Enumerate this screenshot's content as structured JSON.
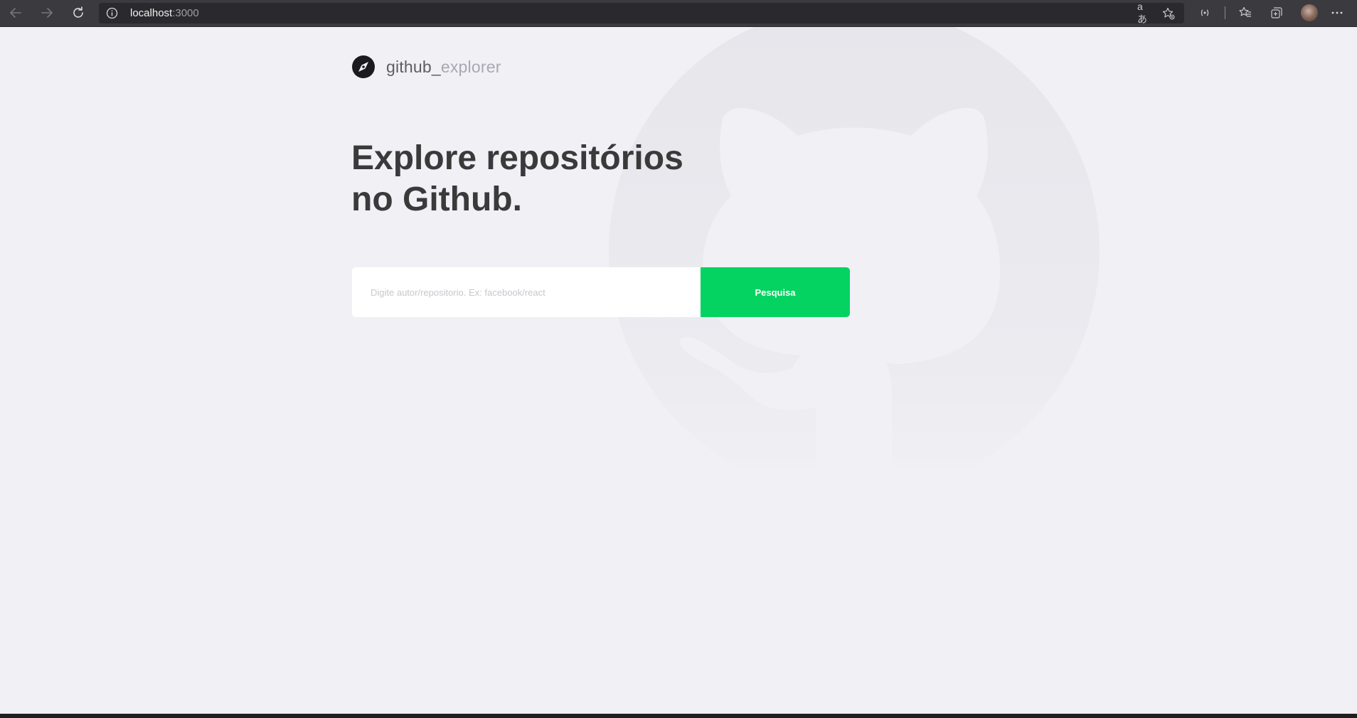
{
  "browser": {
    "url_host": "localhost",
    "url_port": ":3000",
    "translate_glyph": "aあ"
  },
  "header": {
    "brand_main": "github_",
    "brand_light": "explorer"
  },
  "main": {
    "title_line1": "Explore repositórios",
    "title_line2": "no Github."
  },
  "search": {
    "placeholder": "Digite autor/repositorio. Ex: facebook/react",
    "value": "",
    "button_label": "Pesquisa"
  },
  "colors": {
    "background": "#f0f0f5",
    "accent": "#04d361",
    "title": "#3a3a3a",
    "placeholder": "#c7c7cf"
  },
  "icons": [
    "back-arrow-icon",
    "forward-arrow-icon",
    "reload-icon",
    "info-icon",
    "translate-icon",
    "favorite-add-icon",
    "extension-icon",
    "favorites-icon",
    "collections-icon",
    "avatar",
    "more-icon",
    "compass-icon",
    "github-octocat-watermark"
  ]
}
